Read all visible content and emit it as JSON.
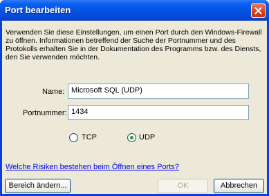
{
  "window": {
    "title": "Port bearbeiten"
  },
  "description": "Verwenden Sie diese Einstellungen, um einen Port durch den Windows-Firewall zu öffnen. Informationen betreffend der Suche der Portnummer und des Protokolls erhalten Sie in der Dokumentation des Programms bzw. des Diensts, den Sie verwenden möchten.",
  "form": {
    "name_label": "Name:",
    "name_value": "Microsoft SQL (UDP)",
    "port_label": "Portnummer:",
    "port_value": "1434",
    "protocol": {
      "tcp_label": "TCP",
      "udp_label": "UDP",
      "selected": "UDP"
    }
  },
  "help_link": "Welche Risiken bestehen beim Öffnen eines Ports?",
  "buttons": {
    "scope": "Bereich ändern...",
    "ok": "OK",
    "cancel": "Abbrechen"
  },
  "colors": {
    "titlebar": "#0553e2",
    "dialog_bg": "#ece9d8",
    "radio_selected": "#21a121",
    "link": "#0000ee"
  }
}
